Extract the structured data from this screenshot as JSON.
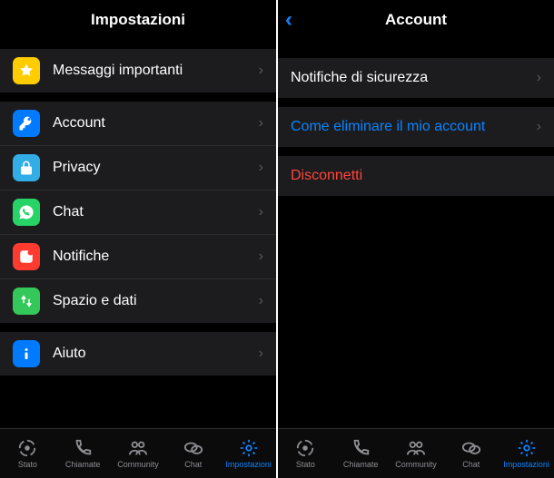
{
  "left": {
    "title": "Impostazioni",
    "starred": {
      "label": "Messaggi importanti"
    },
    "groupA": [
      {
        "key": "account",
        "label": "Account",
        "icon": "key-icon",
        "bg": "bg-blue"
      },
      {
        "key": "privacy",
        "label": "Privacy",
        "icon": "lock-icon",
        "bg": "bg-cyan"
      },
      {
        "key": "chat",
        "label": "Chat",
        "icon": "wa-icon",
        "bg": "bg-green"
      },
      {
        "key": "notif",
        "label": "Notifiche",
        "icon": "bell-icon",
        "bg": "bg-red"
      },
      {
        "key": "storage",
        "label": "Spazio e dati",
        "icon": "updown-icon",
        "bg": "bg-green2"
      }
    ],
    "groupB": [
      {
        "key": "help",
        "label": "Aiuto",
        "icon": "info-icon",
        "bg": "bg-blue2"
      }
    ]
  },
  "right": {
    "title": "Account",
    "rows": {
      "security": "Notifiche di sicurezza",
      "delete": "Come eliminare il mio account",
      "logout": "Disconnetti"
    }
  },
  "tabs": [
    {
      "key": "status",
      "label": "Stato"
    },
    {
      "key": "calls",
      "label": "Chiamate"
    },
    {
      "key": "community",
      "label": "Community"
    },
    {
      "key": "chat",
      "label": "Chat"
    },
    {
      "key": "settings",
      "label": "Impostazioni"
    }
  ]
}
